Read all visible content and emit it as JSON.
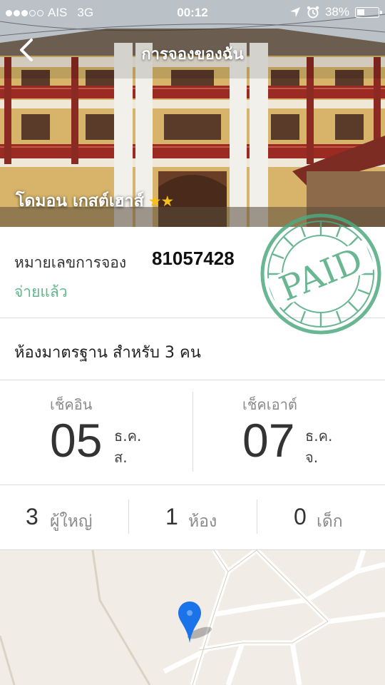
{
  "status_bar": {
    "carrier": "AIS",
    "network": "3G",
    "time": "00:12",
    "battery": "38%",
    "battery_level": 0.38,
    "signal_bars": 3
  },
  "nav": {
    "title": "การจองของฉัน",
    "back_icon": "chevron-left-icon"
  },
  "hotel": {
    "name": "โดมอน เกสต์เฮาส์",
    "stars": "★★",
    "star_count": 2
  },
  "booking": {
    "label": "หมายเลขการจอง",
    "number": "81057428",
    "status": "จ่ายแล้ว",
    "stamp_text": "PAID"
  },
  "room": {
    "description": "ห้องมาตรฐาน สำหรับ 3 คน"
  },
  "checkin": {
    "title": "เช็คอิน",
    "day": "05",
    "month": "ธ.ค.",
    "weekday": "ส."
  },
  "checkout": {
    "title": "เช็คเอาต์",
    "day": "07",
    "month": "ธ.ค.",
    "weekday": "จ."
  },
  "counts": {
    "adults": {
      "value": "3",
      "unit": "ผู้ใหญ่"
    },
    "rooms": {
      "value": "1",
      "unit": "ห้อง"
    },
    "children": {
      "value": "0",
      "unit": "เด็ก"
    }
  },
  "map": {
    "pin_icon": "map-pin-icon"
  },
  "colors": {
    "paid_green": "#5fb88a",
    "star_yellow": "#f6bf1a",
    "pin_blue": "#1a73e8",
    "stamp_green": "#4faa80"
  }
}
